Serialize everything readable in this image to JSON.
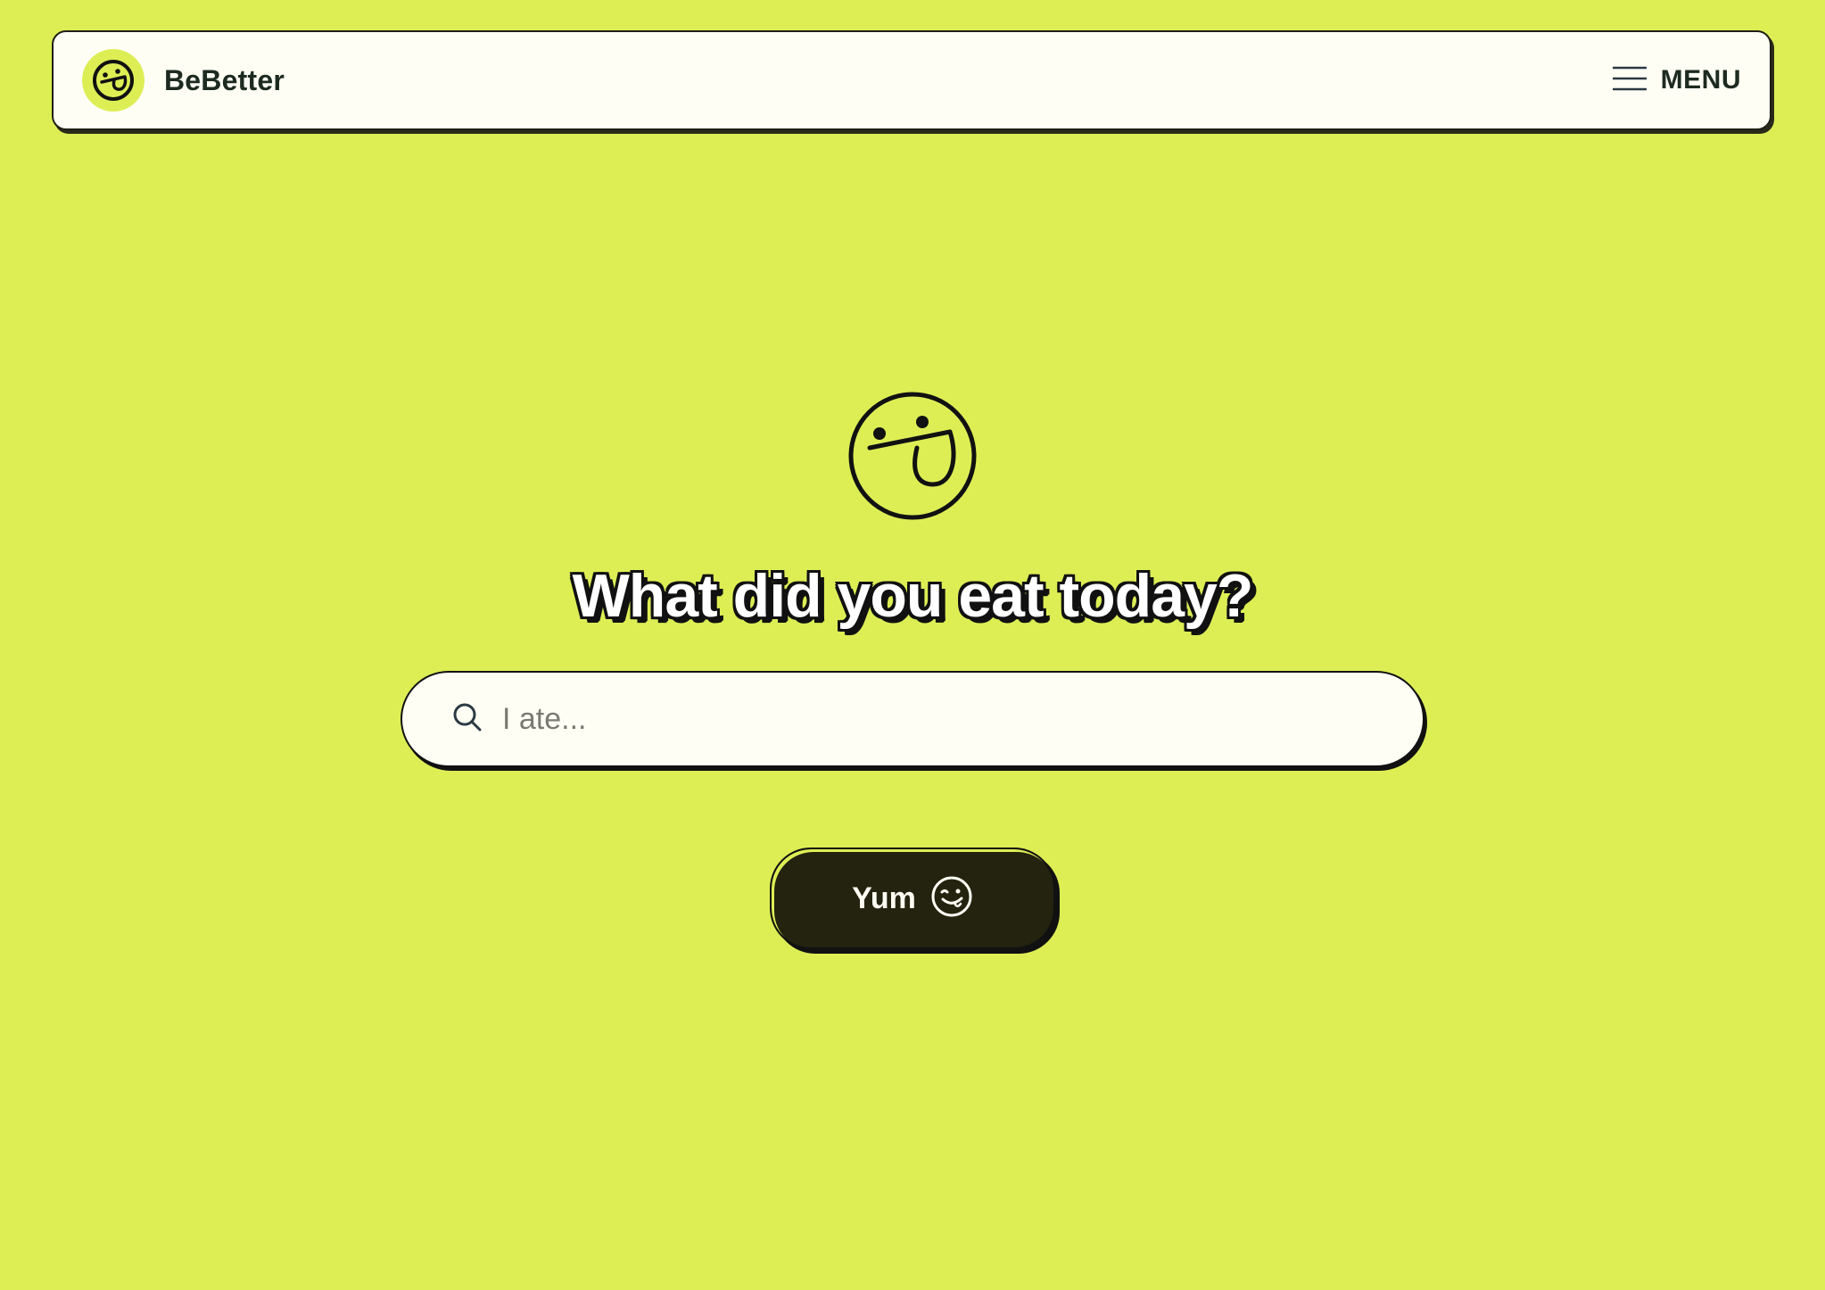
{
  "navbar": {
    "brand_name": "BeBetter",
    "brand_icon": "smiley-tongue-icon",
    "menu_icon": "hamburger-icon",
    "menu_label": "MENU"
  },
  "hero": {
    "icon": "smiley-tongue-icon",
    "headline": "What did you eat today?"
  },
  "search": {
    "icon": "search-icon",
    "placeholder": "I ate...",
    "value": ""
  },
  "submit": {
    "label": "Yum",
    "icon": "wink-smiley-icon"
  },
  "colors": {
    "background": "#ddee55",
    "surface": "#fefef4",
    "ink": "#111111",
    "button": "#23230f"
  }
}
